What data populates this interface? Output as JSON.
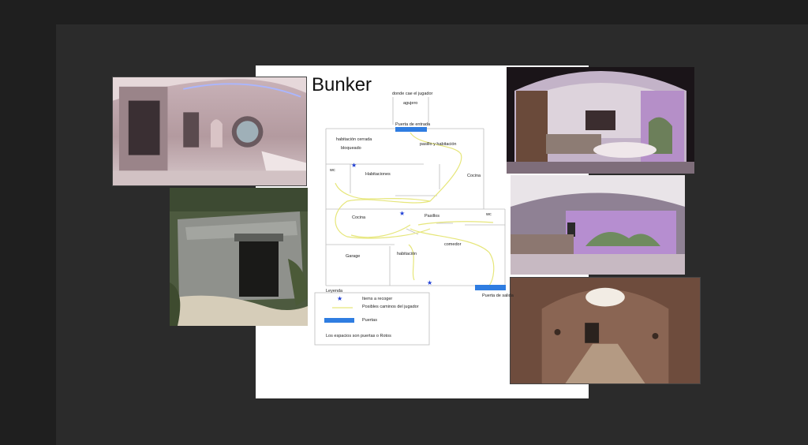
{
  "board": {
    "title": "Bunker"
  },
  "map": {
    "top_labels": {
      "player_fall": "donde cae el jugador",
      "hole": "agujero",
      "entrance": "Puerta de entrada"
    },
    "rooms": {
      "closed_room": "habitación cerrada",
      "blocked": "bloqueado",
      "hall_room": "pasillo y habitación",
      "wc1": "wc",
      "bedrooms": "Habitaciones",
      "kitchen_right": "Cocina",
      "kitchen_mid": "Cocina",
      "halls": "Pasillos",
      "wc2": "wc",
      "dining": "comedor",
      "garage": "Garage",
      "bedroom": "habitación",
      "exit": "Puerta de salida"
    },
    "colors": {
      "door": "#2f7de1",
      "path": "#e6e67a",
      "wall": "#bdbdbd",
      "star": "#1f3fd6"
    }
  },
  "legend": {
    "title": "Leyenda",
    "items_label": "Items a recoger",
    "paths_label": "Posibles caminos del jugador",
    "doors_label": "Puertas",
    "note": "Los espacios son puertas o Rotos"
  }
}
